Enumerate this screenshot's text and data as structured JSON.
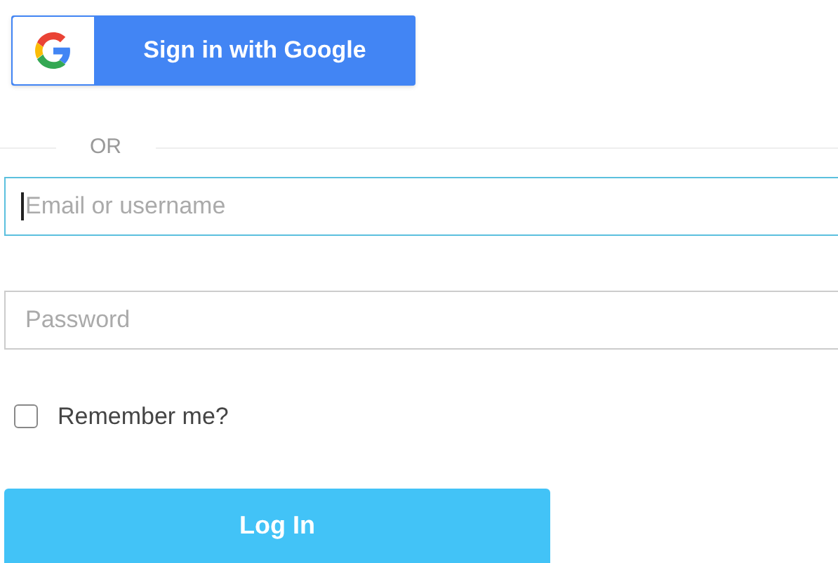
{
  "google_button": {
    "label": "Sign in with Google"
  },
  "divider": {
    "label": "OR"
  },
  "fields": [
    {
      "placeholder": "Email or username",
      "focused": true
    },
    {
      "placeholder": "Password",
      "focused": false
    }
  ],
  "remember": {
    "label": "Remember me?",
    "checked": false
  },
  "login_button": {
    "label": "Log In"
  }
}
